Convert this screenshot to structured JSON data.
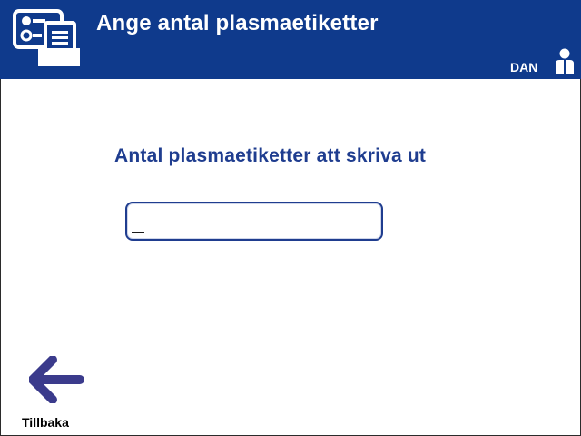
{
  "header": {
    "title": "Ange antal plasmaetiketter",
    "app_icon": "label-printer-icon",
    "user": {
      "label": "DAN",
      "icon": "user-icon"
    }
  },
  "main": {
    "prompt": "Antal plasmaetiketter att skriva ut",
    "count_input": {
      "value": "",
      "placeholder": ""
    }
  },
  "footer": {
    "back": {
      "label": "Tillbaka",
      "icon": "arrow-left-icon"
    }
  },
  "colors": {
    "header_bg": "#0f3a8c",
    "accent": "#1f3d8f",
    "back_arrow": "#3b3b8c",
    "background": "#ffffff"
  }
}
